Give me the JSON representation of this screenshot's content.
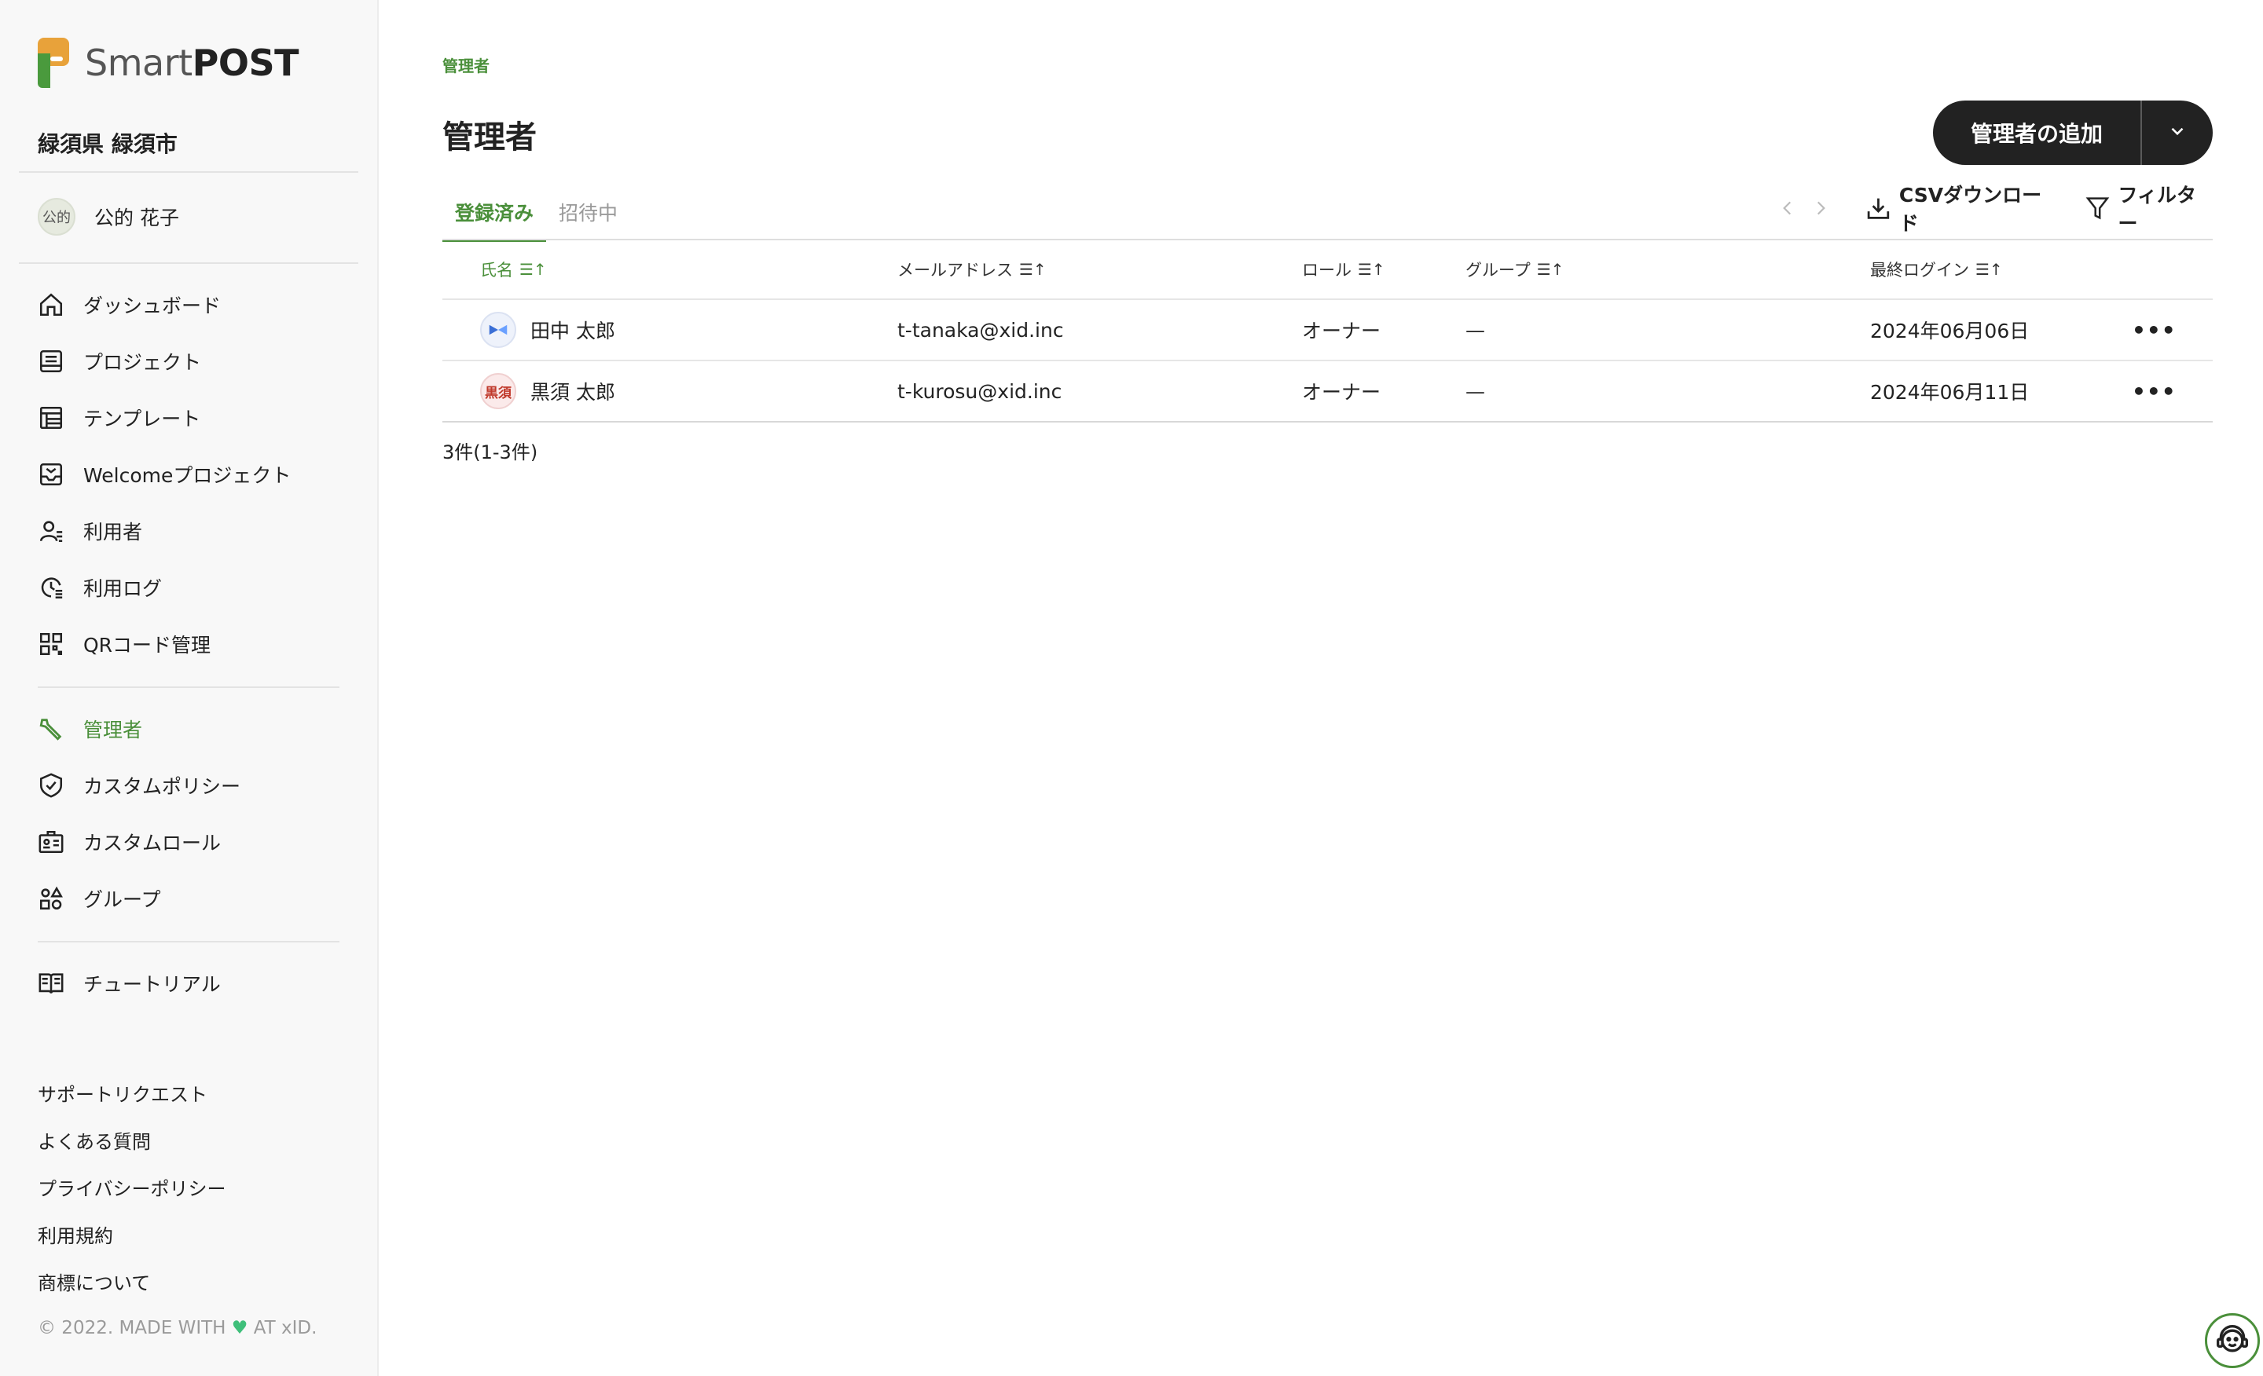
{
  "app": {
    "brand_light": "Smart",
    "brand_bold": "POST"
  },
  "sidebar": {
    "org_name": "緑須県 緑須市",
    "user": {
      "avatar_text": "公的",
      "name": "公的 花子"
    },
    "nav": [
      {
        "label": "ダッシュボード",
        "icon": "home-icon"
      },
      {
        "label": "プロジェクト",
        "icon": "project-icon"
      },
      {
        "label": "テンプレート",
        "icon": "template-icon"
      },
      {
        "label": "Welcomeプロジェクト",
        "icon": "welcome-icon"
      },
      {
        "label": "利用者",
        "icon": "users-icon"
      },
      {
        "label": "利用ログ",
        "icon": "log-icon"
      },
      {
        "label": "QRコード管理",
        "icon": "qr-icon"
      }
    ],
    "admin_nav": [
      {
        "label": "管理者",
        "icon": "wrench-icon",
        "active": true
      },
      {
        "label": "カスタムポリシー",
        "icon": "shield-icon"
      },
      {
        "label": "カスタムロール",
        "icon": "id-card-icon"
      },
      {
        "label": "グループ",
        "icon": "group-icon"
      }
    ],
    "tutorial": {
      "label": "チュートリアル",
      "icon": "book-icon"
    },
    "footer_links": [
      "サポートリクエスト",
      "よくある質問",
      "プライバシーポリシー",
      "利用規約",
      "商標について"
    ],
    "copyright_pre": "© 2022. MADE WITH",
    "copyright_post": "AT xID."
  },
  "main": {
    "breadcrumb": "管理者",
    "title": "管理者",
    "add_button_label": "管理者の追加",
    "tabs": [
      {
        "label": "登録済み",
        "active": true
      },
      {
        "label": "招待中",
        "active": false
      }
    ],
    "toolbar": {
      "csv_label": "CSVダウンロード",
      "filter_label": "フィルター"
    },
    "table": {
      "columns": [
        "氏名",
        "メールアドレス",
        "ロール",
        "グループ",
        "最終ログイン"
      ],
      "sort_glyph": "☰↑",
      "rows": [
        {
          "avatar": "",
          "name": "田中 太郎",
          "email": "t-tanaka@xid.inc",
          "role": "オーナー",
          "group": "—",
          "last_login": "2024年06月06日"
        },
        {
          "avatar": "黒須",
          "name": "黒須 太郎",
          "email": "t-kurosu@xid.inc",
          "role": "オーナー",
          "group": "—",
          "last_login": "2024年06月11日"
        }
      ],
      "more_glyph": "•••"
    },
    "count": "3件(1-3件)"
  },
  "colors": {
    "accent": "#4a8f3a",
    "button_dark": "#222222",
    "sidebar_bg": "#f8f8f8"
  }
}
